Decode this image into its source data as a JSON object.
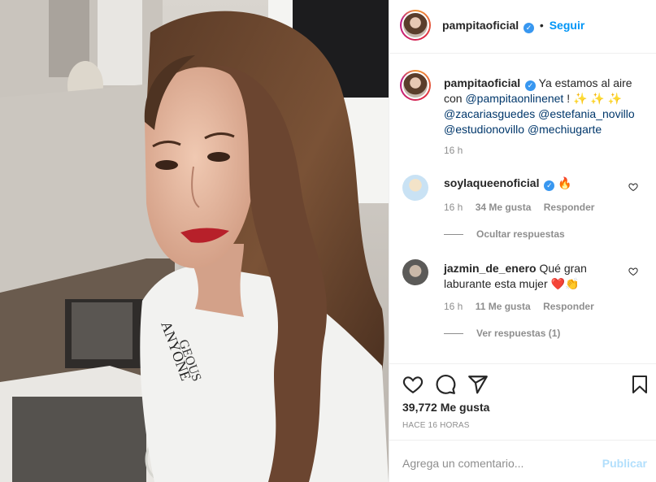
{
  "post": {
    "author": "pampitaoficial",
    "follow_label": "Seguir",
    "dot": "•",
    "verified_mark": "✓",
    "caption": {
      "text_prefix": "Ya estamos al aire con",
      "mention_1": "@pampitaonlinenet",
      "after_mention": "!",
      "emojis": "✨ ✨ ✨",
      "mention_2": "@zacariasguedes",
      "mention_3": "@estefania_novillo",
      "mention_4": "@estudionovillo",
      "mention_5": "@mechiugarte",
      "time": "16 h"
    },
    "comments": [
      {
        "user": "soylaqueenoficial",
        "text": "🔥",
        "time": "16 h",
        "likes": "34 Me gusta",
        "reply": "Responder",
        "replies_toggle": "Ocultar respuestas"
      },
      {
        "user": "jazmin_de_enero",
        "text_1": "Qué gran",
        "text_2": "laburante esta mujer",
        "emoji": "❤️👏",
        "time": "16 h",
        "likes": "11 Me gusta",
        "reply": "Responder",
        "replies_toggle": "Ver respuestas (1)"
      }
    ],
    "likes": "39,772 Me gusta",
    "time_ago": "HACE 16 HORAS",
    "comment_placeholder": "Agrega un comentario...",
    "publish_label": "Publicar"
  },
  "icons": [
    "heart-icon",
    "comment-icon",
    "share-icon",
    "save-icon",
    "verified-icon"
  ],
  "colors": {
    "accent": "#0095f6",
    "link": "#00376b",
    "muted": "#8e8e8e",
    "publish_disabled": "#b2dffc",
    "like_red": "#ed4956"
  }
}
